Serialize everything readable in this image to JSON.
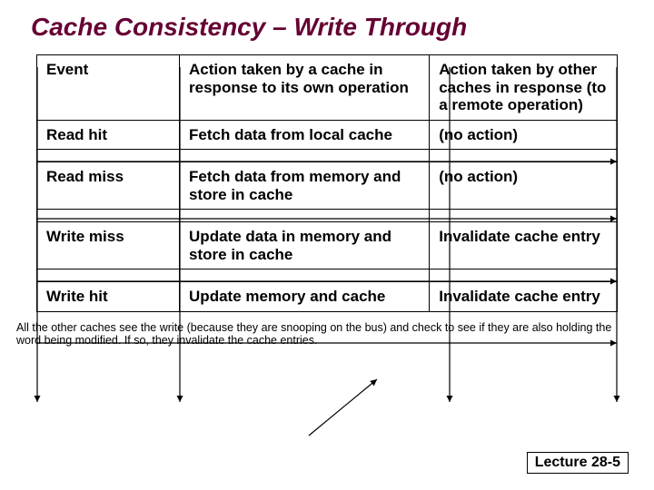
{
  "title": "Cache Consistency – Write Through",
  "table": {
    "headers": {
      "event": "Event",
      "own": "Action taken by a cache in response to its own operation",
      "other": "Action taken by other caches in response (to a remote operation)"
    },
    "rows": [
      {
        "event": "Read hit",
        "own": "Fetch data from local cache",
        "other": "(no action)"
      },
      {
        "event": "Read miss",
        "own": "Fetch data from memory and store in cache",
        "other": "(no action)"
      },
      {
        "event": "Write miss",
        "own": "Update data in memory and store in cache",
        "other": "Invalidate cache entry"
      },
      {
        "event": "Write hit",
        "own": "Update memory and cache",
        "other": "Invalidate cache entry"
      }
    ]
  },
  "footnote": "All the other caches see the write (because they are snooping on the bus) and check to see if they are also holding the word being modified. If so, they invalidate the cache entries.",
  "slide_label": "Lecture 28-5",
  "chart_data": {
    "type": "table",
    "title": "Cache Consistency – Write Through",
    "columns": [
      "Event",
      "Action taken by a cache in response to its own operation",
      "Action taken by other caches in response (to a remote operation)"
    ],
    "rows": [
      [
        "Read hit",
        "Fetch data from local cache",
        "(no action)"
      ],
      [
        "Read miss",
        "Fetch data from memory and store in cache",
        "(no action)"
      ],
      [
        "Write miss",
        "Update data in memory and store in cache",
        "Invalidate cache entry"
      ],
      [
        "Write hit",
        "Update memory and cache",
        "Invalidate cache entry"
      ]
    ]
  }
}
